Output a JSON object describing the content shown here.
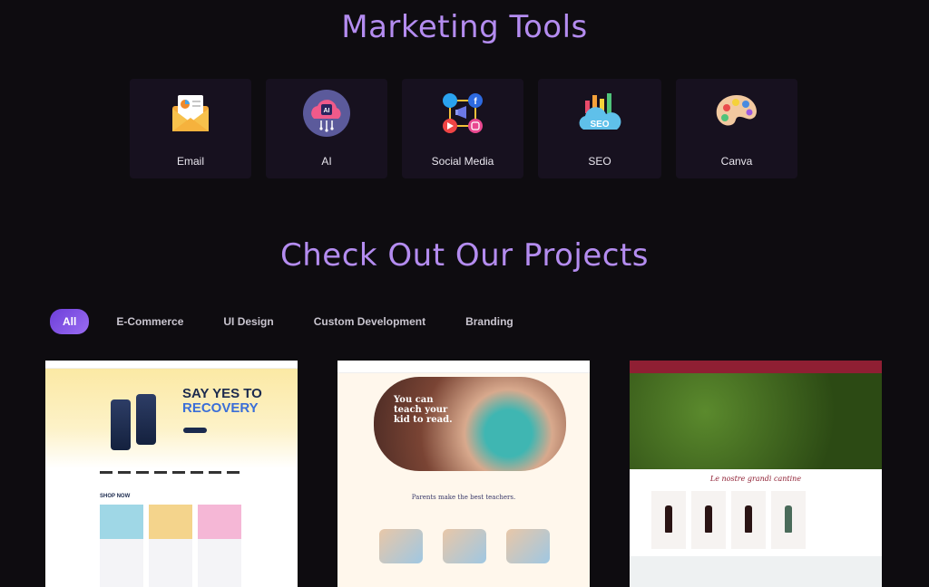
{
  "sections": {
    "tools_title": "Marketing Tools",
    "projects_title": "Check Out Our Projects"
  },
  "tools": [
    {
      "label": "Email",
      "icon": "email-envelope-icon"
    },
    {
      "label": "AI",
      "icon": "ai-cloud-chip-icon"
    },
    {
      "label": "Social Media",
      "icon": "social-media-network-icon"
    },
    {
      "label": "SEO",
      "icon": "seo-cloud-growth-icon"
    },
    {
      "label": "Canva",
      "icon": "paint-palette-icon"
    }
  ],
  "filters": {
    "all": "All",
    "ecommerce": "E-Commerce",
    "ui_design": "UI Design",
    "custom_development": "Custom Development",
    "branding": "Branding",
    "active": "All"
  },
  "projects": {
    "p1": {
      "headline_1": "SAY YES TO",
      "headline_2": "RECOVERY",
      "shop_now": "SHOP NOW"
    },
    "p2": {
      "hero_text": "You can teach your kid to read.",
      "subheading": "Parents make the best teachers."
    },
    "p3": {
      "script_heading": "Le nostre grandi cantine"
    }
  },
  "colors": {
    "background": "#0e0c10",
    "accent": "#b48cf0",
    "card": "#17111f",
    "active_filter": "#7b4ce0"
  }
}
